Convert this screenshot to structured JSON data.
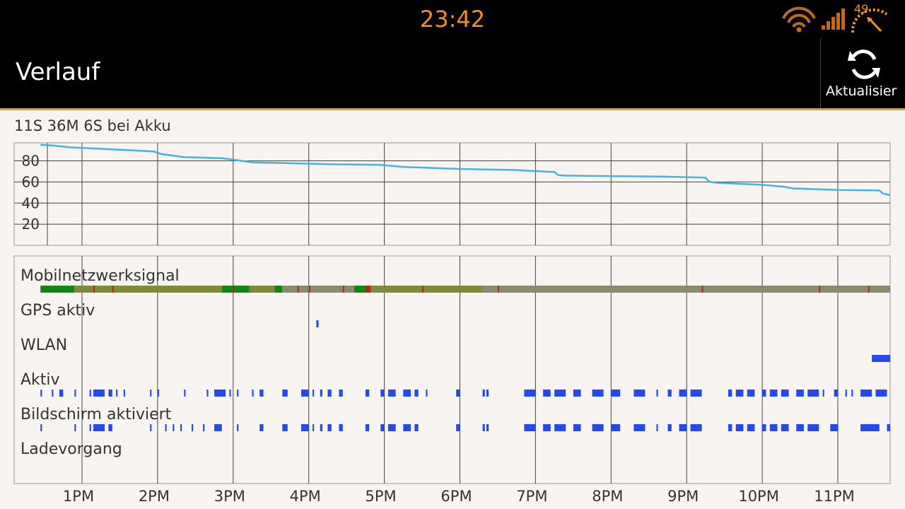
{
  "status_bar": {
    "time": "23:42",
    "battery_percent": "49",
    "icons": [
      "wifi-icon",
      "cell-signal-icon",
      "battery-gauge-icon"
    ]
  },
  "action_bar": {
    "title": "Verlauf",
    "refresh_label": "Aktualisier",
    "refresh_icon": "refresh-icon"
  },
  "summary_text": "11S 36M 6S bei Akku",
  "colors": {
    "accent": "#f0921f",
    "battery_line": "#45b3e0",
    "signal_good": "#108810",
    "signal_moderate": "#7f8a3a",
    "signal_poor": "#b02a10",
    "signal_none": "#8a8a6e",
    "event_bar": "#2449f2"
  },
  "chart_data": {
    "type": "line",
    "title": "",
    "xlabel": "",
    "ylabel": "",
    "x_ticks": [
      "1PM",
      "2PM",
      "3PM",
      "4PM",
      "5PM",
      "6PM",
      "7PM",
      "8PM",
      "9PM",
      "10PM",
      "11PM"
    ],
    "y_ticks": [
      "80",
      "60",
      "40",
      "20"
    ],
    "ylim": [
      0,
      100
    ],
    "xlim_hours": [
      12.45,
      23.7
    ],
    "grid": true,
    "series": [
      {
        "x": [
          12.45,
          12.6,
          12.85,
          13.3,
          13.95,
          14.05,
          14.35,
          14.85,
          15.0,
          15.25,
          15.8,
          16.3,
          16.95,
          17.25,
          18.0,
          18.7,
          19.25,
          19.3,
          19.4,
          20.0,
          20.7,
          21.25,
          21.3,
          21.4,
          22.0,
          22.3,
          22.4,
          23.0,
          23.55,
          23.6,
          23.7
        ],
        "y": [
          98,
          97.5,
          95.5,
          94,
          91.5,
          89,
          86,
          85,
          83.5,
          81,
          80,
          79,
          78.5,
          76.5,
          74.5,
          73.5,
          71.5,
          68.5,
          68,
          67.5,
          67,
          66,
          62,
          61,
          59,
          57,
          55.5,
          54,
          53.5,
          50.5,
          49
        ]
      }
    ],
    "event_rows": [
      {
        "label": "Mobilnetzwerksignal"
      },
      {
        "label": "GPS aktiv"
      },
      {
        "label": "WLAN"
      },
      {
        "label": "Aktiv"
      },
      {
        "label": "Bildschirm aktiviert"
      },
      {
        "label": "Ladevorgang"
      }
    ],
    "signal_segments": [
      {
        "from": 12.45,
        "to": 12.9,
        "level": "good"
      },
      {
        "from": 12.9,
        "to": 14.85,
        "level": "moderate"
      },
      {
        "from": 14.85,
        "to": 15.2,
        "level": "good"
      },
      {
        "from": 15.2,
        "to": 15.22,
        "level": "good"
      },
      {
        "from": 15.22,
        "to": 15.55,
        "level": "moderate"
      },
      {
        "from": 15.55,
        "to": 15.65,
        "level": "good"
      },
      {
        "from": 15.65,
        "to": 16.6,
        "level": "none"
      },
      {
        "from": 16.6,
        "to": 16.75,
        "level": "good"
      },
      {
        "from": 16.75,
        "to": 16.82,
        "level": "poor"
      },
      {
        "from": 16.82,
        "to": 18.3,
        "level": "moderate"
      },
      {
        "from": 18.3,
        "to": 23.7,
        "level": "none"
      }
    ],
    "signal_marks": [
      13.15,
      13.4,
      15.0,
      15.85,
      16.0,
      16.45,
      17.5,
      18.5,
      21.2,
      22.75,
      23.4
    ],
    "gps_events": [
      {
        "from": 16.1,
        "to": 16.13
      }
    ],
    "wlan_events": [
      {
        "from": 23.45,
        "to": 23.7
      }
    ],
    "active_events": [
      {
        "from": 12.45,
        "to": 12.47
      },
      {
        "from": 12.6,
        "to": 12.62
      },
      {
        "from": 12.7,
        "to": 12.75
      },
      {
        "from": 12.9,
        "to": 12.92
      },
      {
        "from": 13.1,
        "to": 13.12
      },
      {
        "from": 13.15,
        "to": 13.3
      },
      {
        "from": 13.35,
        "to": 13.4
      },
      {
        "from": 13.45,
        "to": 13.47
      },
      {
        "from": 13.55,
        "to": 13.57
      },
      {
        "from": 13.9,
        "to": 13.92
      },
      {
        "from": 14.0,
        "to": 14.02
      },
      {
        "from": 14.35,
        "to": 14.37
      },
      {
        "from": 14.65,
        "to": 14.67
      },
      {
        "from": 14.75,
        "to": 14.9
      },
      {
        "from": 14.95,
        "to": 14.97
      },
      {
        "from": 15.05,
        "to": 15.07
      },
      {
        "from": 15.25,
        "to": 15.27
      },
      {
        "from": 15.35,
        "to": 15.4
      },
      {
        "from": 15.65,
        "to": 15.72
      },
      {
        "from": 15.9,
        "to": 16.0
      },
      {
        "from": 16.05,
        "to": 16.07
      },
      {
        "from": 16.15,
        "to": 16.18
      },
      {
        "from": 16.25,
        "to": 16.3
      },
      {
        "from": 16.4,
        "to": 16.45
      },
      {
        "from": 16.75,
        "to": 16.8
      },
      {
        "from": 16.95,
        "to": 17.0
      },
      {
        "from": 17.05,
        "to": 17.15
      },
      {
        "from": 17.25,
        "to": 17.35
      },
      {
        "from": 17.4,
        "to": 17.45
      },
      {
        "from": 17.55,
        "to": 17.57
      },
      {
        "from": 17.95,
        "to": 18.0
      },
      {
        "from": 18.3,
        "to": 18.33
      },
      {
        "from": 18.35,
        "to": 18.38
      },
      {
        "from": 18.85,
        "to": 19.0
      },
      {
        "from": 19.1,
        "to": 19.2
      },
      {
        "from": 19.25,
        "to": 19.4
      },
      {
        "from": 19.5,
        "to": 19.6
      },
      {
        "from": 19.75,
        "to": 19.9
      },
      {
        "from": 20.0,
        "to": 20.12
      },
      {
        "from": 20.3,
        "to": 20.45
      },
      {
        "from": 20.6,
        "to": 20.62
      },
      {
        "from": 20.75,
        "to": 20.8
      },
      {
        "from": 20.9,
        "to": 21.0
      },
      {
        "from": 21.05,
        "to": 21.2
      },
      {
        "from": 21.55,
        "to": 21.6
      },
      {
        "from": 21.65,
        "to": 21.75
      },
      {
        "from": 21.8,
        "to": 21.9
      },
      {
        "from": 22.0,
        "to": 22.05
      },
      {
        "from": 22.1,
        "to": 22.2
      },
      {
        "from": 22.25,
        "to": 22.35
      },
      {
        "from": 22.45,
        "to": 22.55
      },
      {
        "from": 22.6,
        "to": 22.75
      },
      {
        "from": 22.8,
        "to": 22.82
      },
      {
        "from": 22.95,
        "to": 23.0
      },
      {
        "from": 23.1,
        "to": 23.12
      },
      {
        "from": 23.18,
        "to": 23.2
      },
      {
        "from": 23.3,
        "to": 23.45
      },
      {
        "from": 23.5,
        "to": 23.65
      },
      {
        "from": 23.8,
        "to": 24.0
      }
    ],
    "screen_events": [
      {
        "from": 12.45,
        "to": 12.47
      },
      {
        "from": 12.9,
        "to": 12.92
      },
      {
        "from": 13.1,
        "to": 13.12
      },
      {
        "from": 13.15,
        "to": 13.3
      },
      {
        "from": 13.35,
        "to": 13.4
      },
      {
        "from": 13.9,
        "to": 13.92
      },
      {
        "from": 14.1,
        "to": 14.12
      },
      {
        "from": 14.2,
        "to": 14.22
      },
      {
        "from": 14.3,
        "to": 14.32
      },
      {
        "from": 14.45,
        "to": 14.47
      },
      {
        "from": 14.6,
        "to": 14.62
      },
      {
        "from": 14.75,
        "to": 14.85
      },
      {
        "from": 15.05,
        "to": 15.07
      },
      {
        "from": 15.35,
        "to": 15.4
      },
      {
        "from": 15.65,
        "to": 15.72
      },
      {
        "from": 15.9,
        "to": 16.0
      },
      {
        "from": 16.05,
        "to": 16.07
      },
      {
        "from": 16.15,
        "to": 16.18
      },
      {
        "from": 16.25,
        "to": 16.3
      },
      {
        "from": 16.4,
        "to": 16.45
      },
      {
        "from": 16.75,
        "to": 16.8
      },
      {
        "from": 16.95,
        "to": 17.0
      },
      {
        "from": 17.05,
        "to": 17.15
      },
      {
        "from": 17.25,
        "to": 17.35
      },
      {
        "from": 17.4,
        "to": 17.45
      },
      {
        "from": 17.95,
        "to": 18.0
      },
      {
        "from": 18.3,
        "to": 18.33
      },
      {
        "from": 18.35,
        "to": 18.38
      },
      {
        "from": 18.85,
        "to": 19.0
      },
      {
        "from": 19.1,
        "to": 19.2
      },
      {
        "from": 19.25,
        "to": 19.4
      },
      {
        "from": 19.5,
        "to": 19.6
      },
      {
        "from": 19.75,
        "to": 19.9
      },
      {
        "from": 20.0,
        "to": 20.12
      },
      {
        "from": 20.3,
        "to": 20.45
      },
      {
        "from": 20.6,
        "to": 20.62
      },
      {
        "from": 20.75,
        "to": 20.8
      },
      {
        "from": 20.9,
        "to": 21.0
      },
      {
        "from": 21.05,
        "to": 21.2
      },
      {
        "from": 21.55,
        "to": 21.6
      },
      {
        "from": 21.65,
        "to": 21.75
      },
      {
        "from": 21.8,
        "to": 21.9
      },
      {
        "from": 22.0,
        "to": 22.05
      },
      {
        "from": 22.1,
        "to": 22.2
      },
      {
        "from": 22.25,
        "to": 22.35
      },
      {
        "from": 22.45,
        "to": 22.55
      },
      {
        "from": 22.6,
        "to": 22.75
      },
      {
        "from": 22.9,
        "to": 23.0
      },
      {
        "from": 23.3,
        "to": 23.55
      },
      {
        "from": 23.65,
        "to": 23.8
      },
      {
        "from": 23.9,
        "to": 24.0
      }
    ]
  }
}
